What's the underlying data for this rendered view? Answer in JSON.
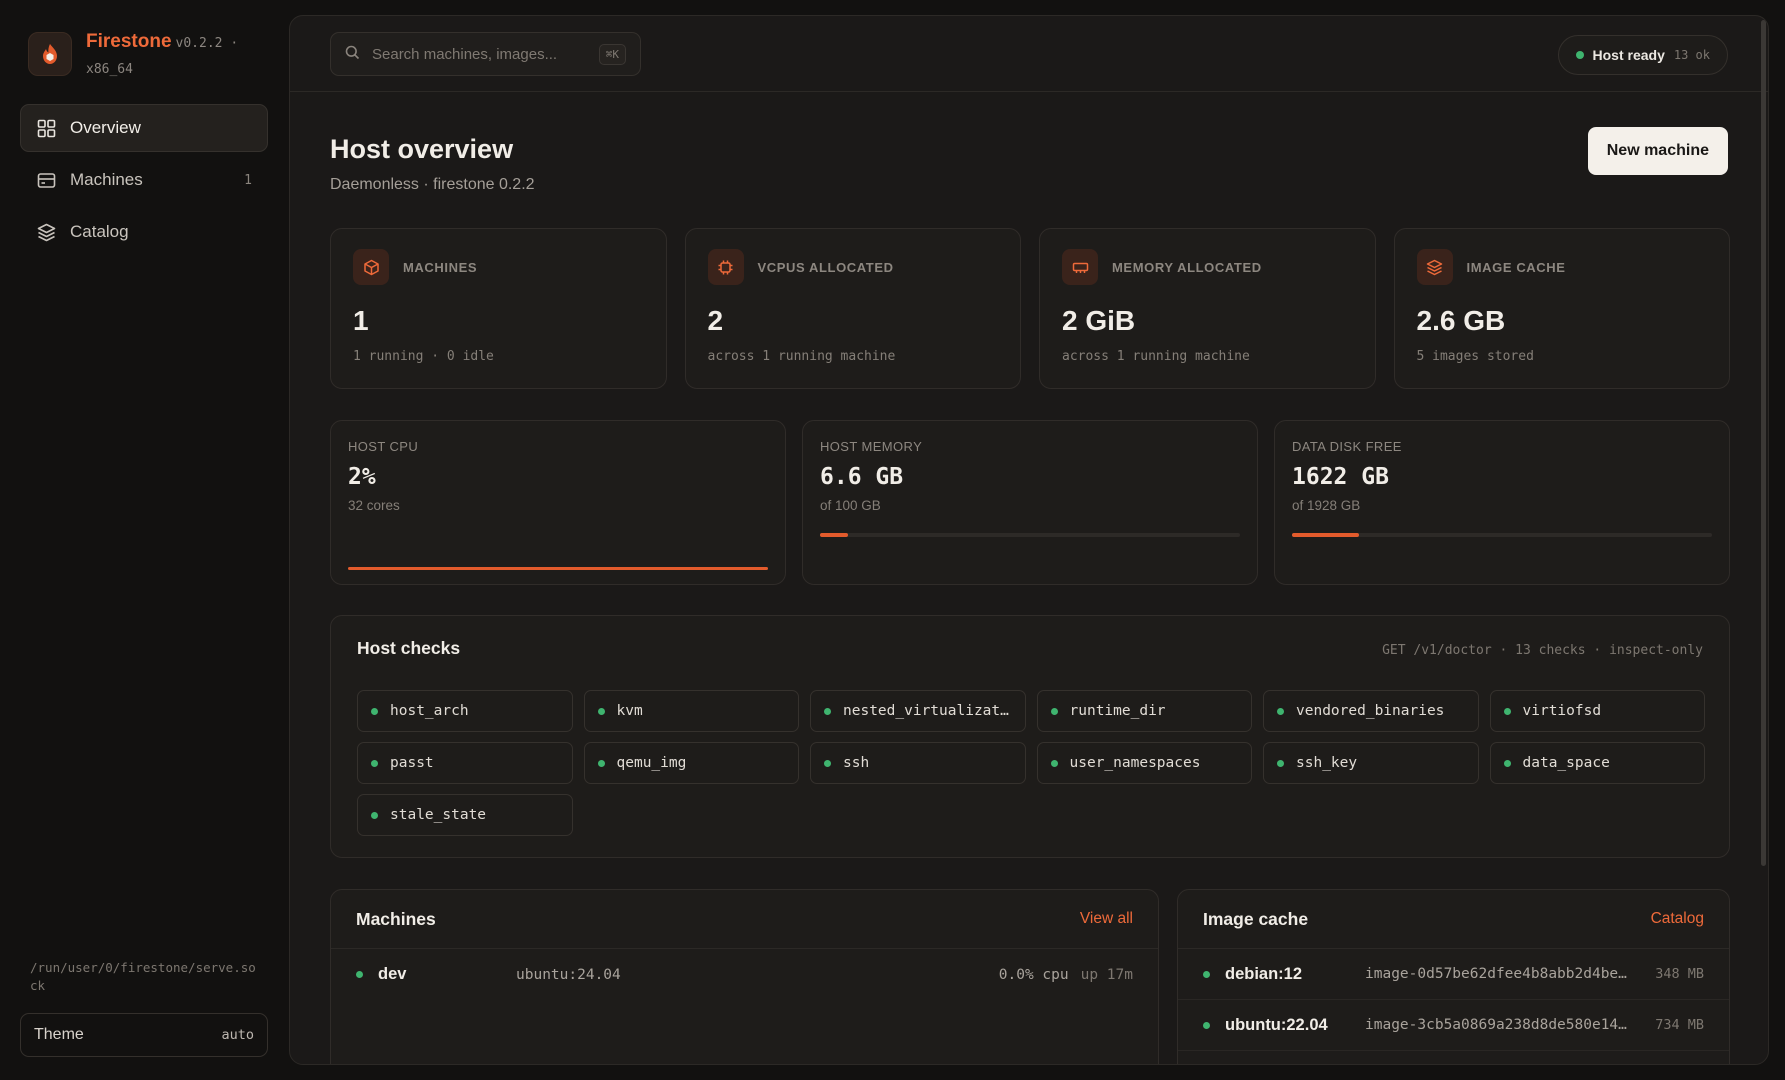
{
  "app": {
    "name": "Firestone",
    "version": "v0.2.2 ·",
    "arch": "x86_64"
  },
  "sidebar": {
    "items": [
      {
        "label": "Overview",
        "icon": "grid-icon",
        "count": ""
      },
      {
        "label": "Machines",
        "icon": "server-icon",
        "count": "1"
      },
      {
        "label": "Catalog",
        "icon": "layers-icon",
        "count": ""
      }
    ],
    "socket_path": "/run/user/0/firestone/serve.sock",
    "theme_label": "Theme",
    "theme_value": "auto"
  },
  "topbar": {
    "search_placeholder": "Search machines, images...",
    "search_shortcut": "⌘K",
    "status_label": "Host ready",
    "status_count": "13 ok",
    "status_color": "#3fb46f"
  },
  "header": {
    "title": "Host overview",
    "subtitle": "Daemonless · firestone 0.2.2",
    "new_button": "New machine"
  },
  "stats": [
    {
      "label": "MACHINES",
      "icon": "cube-icon",
      "value": "1",
      "sub": "1 running · 0 idle"
    },
    {
      "label": "VCPUS ALLOCATED",
      "icon": "cpu-icon",
      "value": "2",
      "sub": "across 1 running machine"
    },
    {
      "label": "MEMORY ALLOCATED",
      "icon": "memory-icon",
      "value": "2 GiB",
      "sub": "across 1 running machine"
    },
    {
      "label": "IMAGE CACHE",
      "icon": "layers-icon",
      "value": "2.6 GB",
      "sub": "5 images stored"
    }
  ],
  "resources": {
    "cpu": {
      "label": "HOST CPU",
      "value": "2%",
      "sub": "32 cores",
      "fraction": 1.0
    },
    "memory": {
      "label": "HOST MEMORY",
      "value": "6.6 GB",
      "sub": "of 100 GB",
      "fraction": 0.066
    },
    "disk": {
      "label": "DATA DISK FREE",
      "value": "1622 GB",
      "sub": "of 1928 GB",
      "fraction": 0.159
    }
  },
  "accent_color": "#e35b2c",
  "checks": {
    "title": "Host checks",
    "meta": "GET /v1/doctor · 13 checks · inspect-only",
    "items": [
      "host_arch",
      "kvm",
      "nested_virtualization",
      "runtime_dir",
      "vendored_binaries",
      "virtiofsd",
      "passt",
      "qemu_img",
      "ssh",
      "user_namespaces",
      "ssh_key",
      "data_space",
      "stale_state"
    ]
  },
  "machines_panel": {
    "title": "Machines",
    "link": "View all",
    "rows": [
      {
        "name": "dev",
        "image": "ubuntu:24.04",
        "cpu": "0.0% cpu",
        "uptime": "up 17m"
      }
    ]
  },
  "images_panel": {
    "title": "Image cache",
    "link": "Catalog",
    "rows": [
      {
        "name": "debian:12",
        "id": "image-0d57be62dfee4b8abb2d4be…",
        "size": "348 MB"
      },
      {
        "name": "ubuntu:22.04",
        "id": "image-3cb5a0869a238d8de580e14…",
        "size": "734 MB"
      }
    ]
  }
}
